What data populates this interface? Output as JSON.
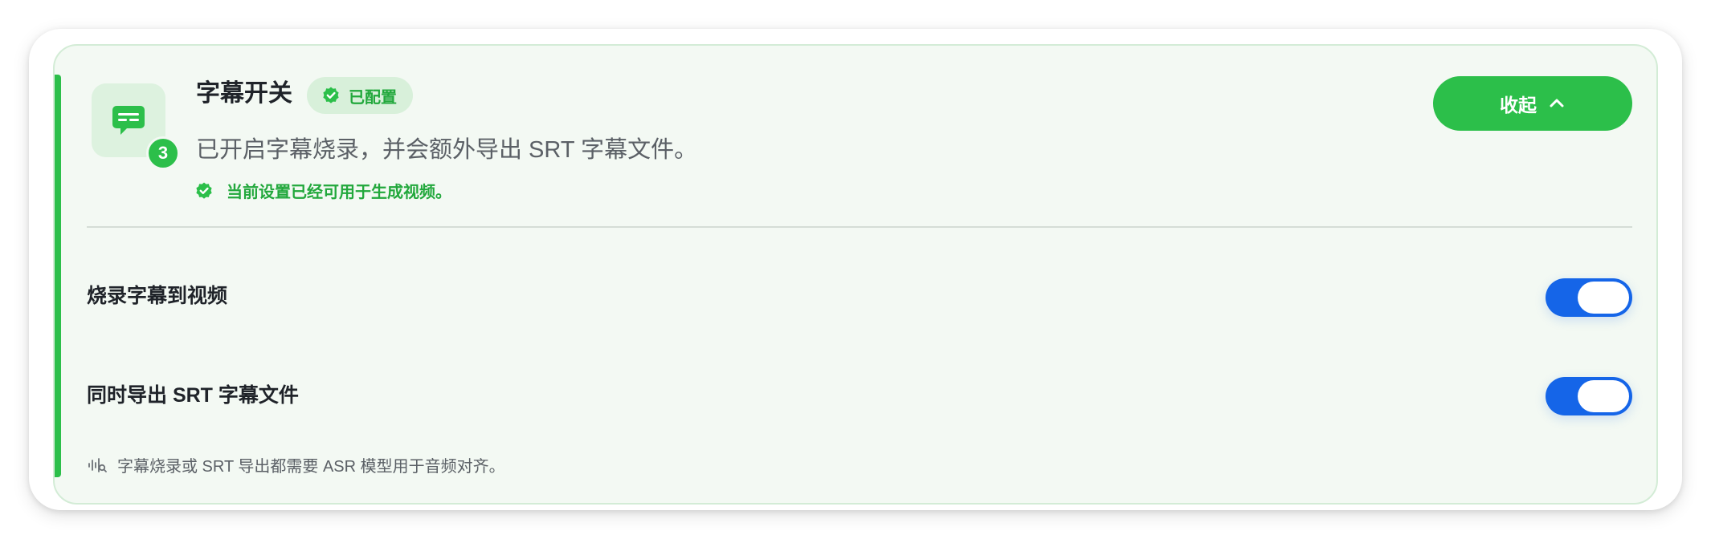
{
  "section": {
    "title": "字幕开关",
    "step_number": "3",
    "status_badge": "已配置",
    "description": "已开启字幕烧录，并会额外导出 SRT 字幕文件。",
    "ready_text": "当前设置已经可用于生成视频。",
    "collapse_label": "收起",
    "icon": "subtitles-icon"
  },
  "settings": [
    {
      "label": "烧录字幕到视频",
      "enabled": true
    },
    {
      "label": "同时导出 SRT 字幕文件",
      "enabled": true
    }
  ],
  "note": {
    "icon": "audio-wave-icon",
    "text": "字幕烧录或 SRT 导出都需要 ASR 模型用于音频对齐。"
  },
  "colors": {
    "accent_green": "#2cbf4a",
    "toggle_blue": "#1565e8",
    "panel_background": "#f3f9f3"
  }
}
